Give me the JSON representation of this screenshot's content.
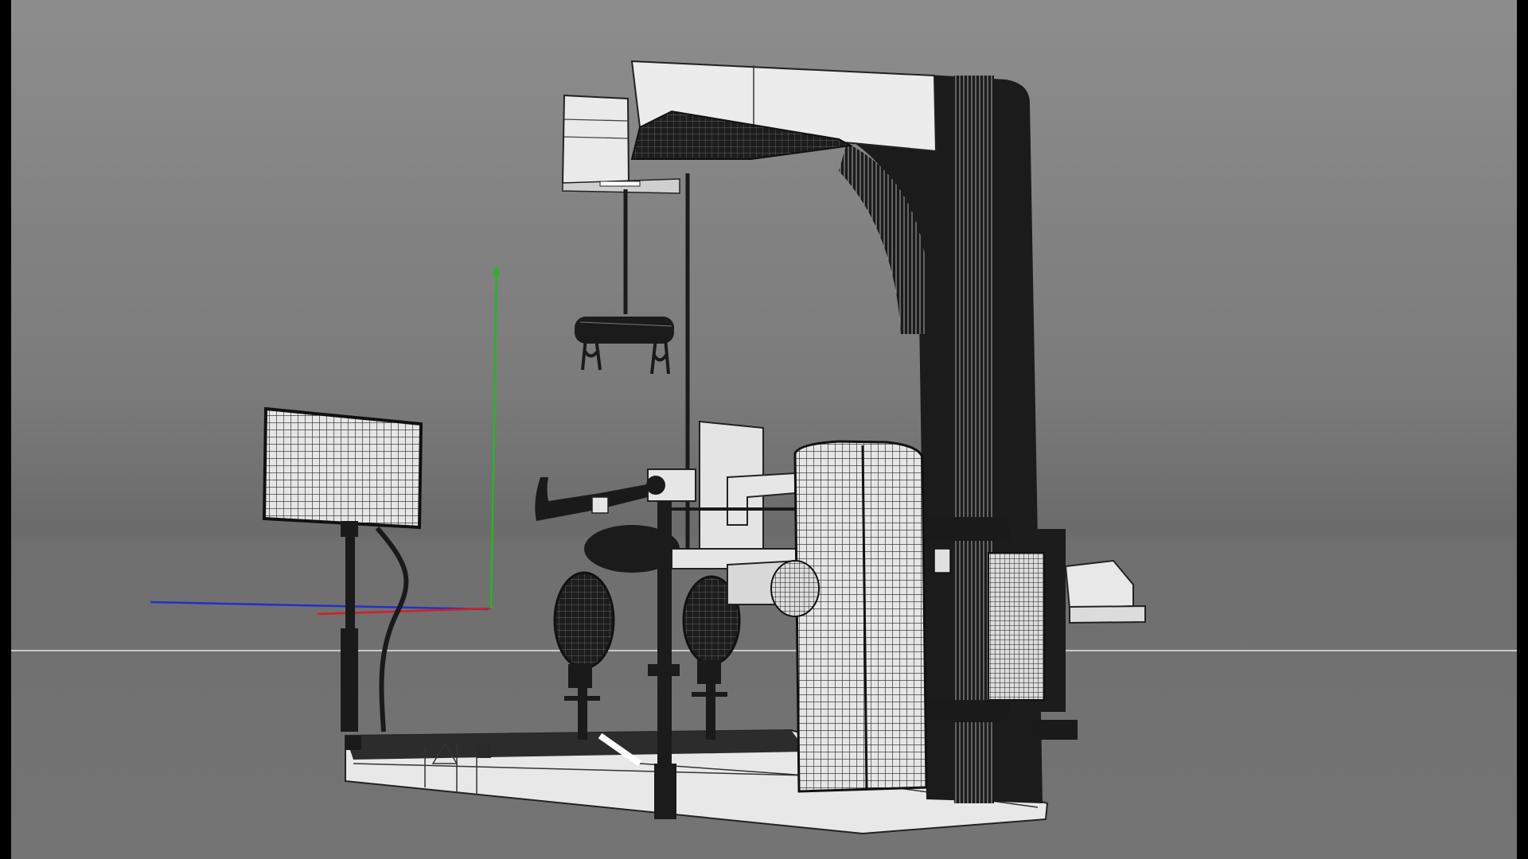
{
  "viewport": {
    "background_top": "#8d8d8d",
    "background_bottom": "#747474",
    "horizon_color": "#c9c9c9"
  },
  "gizmo": {
    "x_axis_color": "#d42020",
    "y_axis_color": "#22b822",
    "z_axis_color": "#2430c8"
  },
  "model": {
    "wire_color": "#111111",
    "surface_color": "#e9e9e9",
    "dark_color": "#1a1a1a"
  }
}
